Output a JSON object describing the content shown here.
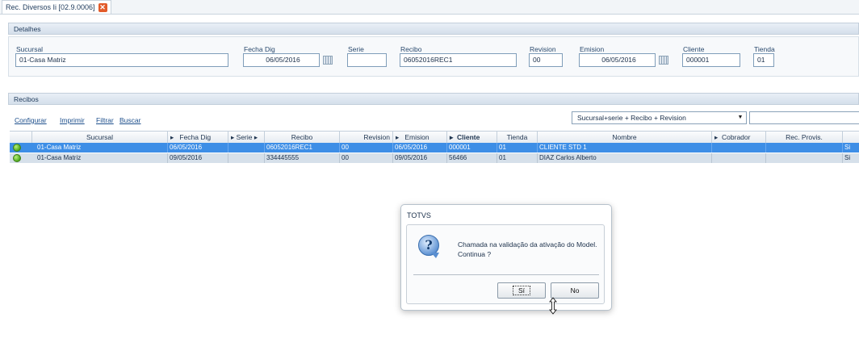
{
  "tab": {
    "title": "Rec. Diversos Ii [02.9.0006]",
    "close": "✕"
  },
  "detalhes": {
    "header": "Detalhes",
    "sucursal_label": "Sucursal",
    "sucursal_value": "01-Casa Matriz",
    "fecha_label": "Fecha Dig",
    "fecha_value": "06/05/2016",
    "serie_label": "Serie",
    "serie_value": "",
    "recibo_label": "Recibo",
    "recibo_value": "06052016REC1",
    "revision_label": "Revision",
    "revision_value": "00",
    "emision_label": "Emision",
    "emision_value": "06/05/2016",
    "cliente_label": "Cliente",
    "cliente_value": "000001",
    "tienda_label": "Tienda",
    "tienda_value": "01"
  },
  "recibos": {
    "header": "Recibos",
    "links": {
      "configurar": "Configurar",
      "imprimir": "Imprimir",
      "filtrar": "Filtrar",
      "buscar": "Buscar"
    },
    "order_combo": "Sucursal+serie + Recibo + Revision",
    "columns": {
      "sucursal": "Sucursal",
      "fecha": "Fecha Dig",
      "serie": "Serie",
      "recibo": "Recibo",
      "revision": "Revision",
      "emision": "Emision",
      "cliente": "Cliente",
      "tienda": "Tienda",
      "nombre": "Nombre",
      "cobrador": "Cobrador",
      "rec_provis": "Rec. Provis."
    },
    "rows": [
      {
        "sucursal": "01-Casa Matriz",
        "fecha": "06/05/2016",
        "serie": "",
        "recibo": "06052016REC1",
        "revision": "00",
        "emision": "06/05/2016",
        "cliente": "000001",
        "tienda": "01",
        "nombre": "CLIENTE STD 1",
        "cobrador": "",
        "rec_provis": "",
        "extra": "Si"
      },
      {
        "sucursal": "01-Casa Matriz",
        "fecha": "09/05/2016",
        "serie": "",
        "recibo": "334445555",
        "revision": "00",
        "emision": "09/05/2016",
        "cliente": "56466",
        "tienda": "01",
        "nombre": "DIAZ Carlos Alberto",
        "cobrador": "",
        "rec_provis": "",
        "extra": "Si"
      }
    ]
  },
  "dialog": {
    "title": "TOTVS",
    "icon": "?",
    "message_line1": "Chamada na validação da ativação do Model.",
    "message_line2": "Continua ?",
    "yes": "Sí",
    "no": "No"
  }
}
